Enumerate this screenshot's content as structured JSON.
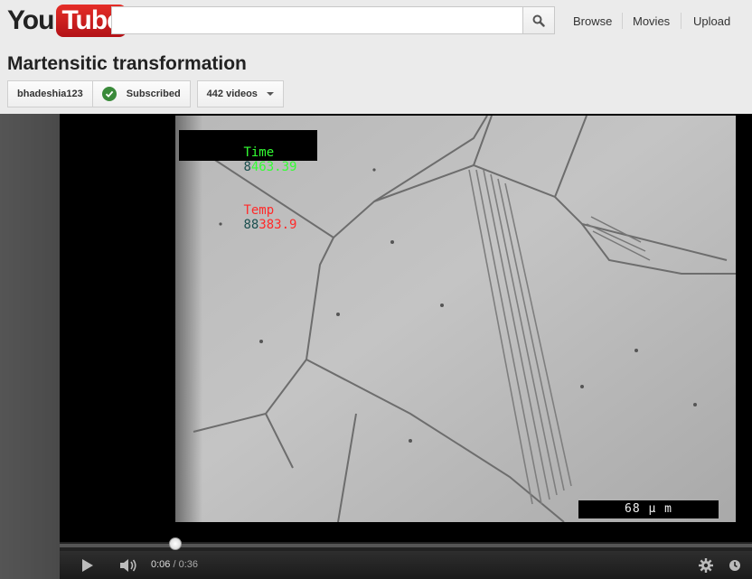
{
  "masthead": {
    "logo_you": "You",
    "logo_tube": "Tube",
    "search_placeholder": "",
    "nav": [
      "Browse",
      "Movies",
      "Upload"
    ]
  },
  "video": {
    "title": "Martensitic transformation",
    "channel": "bhadeshia123",
    "subscribe_state": "Subscribed",
    "videos_count": "442 videos"
  },
  "frame_overlay": {
    "time_label": "Time",
    "time_value": "463.39",
    "temp_label": "Temp",
    "temp_value": "383.9",
    "scale_label": "68 μ m"
  },
  "player": {
    "current_time": "0:06",
    "separator": " / ",
    "duration": "0:36",
    "played_fraction": 0.167,
    "colors": {
      "played": "#c80000",
      "overlay_green": "#33ff33",
      "overlay_red": "#ff2a2a"
    }
  }
}
